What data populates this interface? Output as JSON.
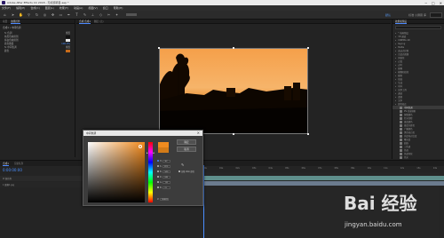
{
  "window": {
    "title": "Adobe After Effects CC 2018 - 无标题项目.aep *"
  },
  "menu": [
    "文件(F)",
    "编辑(E)",
    "合成(C)",
    "图层(L)",
    "效果(T)",
    "动画(A)",
    "视图(V)",
    "窗口",
    "帮助(H)"
  ],
  "toolbar": {
    "workspace_active": "默认",
    "workspace_other": "标准  小屏幕  库"
  },
  "left_panel": {
    "tabs": [
      "项目",
      "效果控件"
    ],
    "header": "合成1 • 中间色调",
    "rows": [
      {
        "label": "fx 色调",
        "value": "重置"
      },
      {
        "label": "将黑色映射到",
        "value": ""
      },
      {
        "label": "将白色映射到",
        "value": ""
      },
      {
        "label": "着色数量",
        "value": "100.0%"
      },
      {
        "label": "fx 中间色调",
        "value": "重置"
      },
      {
        "label": "颜色",
        "value": ""
      }
    ]
  },
  "comp_panel": {
    "tabs": [
      "合成 合成1",
      "图层 (无)"
    ]
  },
  "effects_panel": {
    "title": "效果和预设",
    "items": [
      {
        "label": "* 动画预设",
        "sub": false,
        "selected": false
      },
      {
        "label": "3D 通道",
        "sub": false,
        "selected": false
      },
      {
        "label": "CINEMA 4D",
        "sub": false,
        "selected": false
      },
      {
        "label": "Keying",
        "sub": false,
        "selected": false
      },
      {
        "label": "Matte",
        "sub": false,
        "selected": false
      },
      {
        "label": "表达式控制",
        "sub": false,
        "selected": false
      },
      {
        "label": "沉浸式视频",
        "sub": false,
        "selected": false
      },
      {
        "label": "风格化",
        "sub": false,
        "selected": false
      },
      {
        "label": "过渡",
        "sub": false,
        "selected": false
      },
      {
        "label": "过时",
        "sub": false,
        "selected": false
      },
      {
        "label": "抠像",
        "sub": false,
        "selected": false
      },
      {
        "label": "模糊和锐化",
        "sub": false,
        "selected": false
      },
      {
        "label": "模拟",
        "sub": false,
        "selected": false
      },
      {
        "label": "扭曲",
        "sub": false,
        "selected": false
      },
      {
        "label": "生成",
        "sub": false,
        "selected": false
      },
      {
        "label": "时间",
        "sub": false,
        "selected": false
      },
      {
        "label": "实用工具",
        "sub": false,
        "selected": false
      },
      {
        "label": "通道",
        "sub": false,
        "selected": false
      },
      {
        "label": "透视",
        "sub": false,
        "selected": false
      },
      {
        "label": "文本",
        "sub": false,
        "selected": false
      },
      {
        "label": "颜色校正",
        "sub": false,
        "selected": false
      },
      {
        "label": "中间色调",
        "sub": true,
        "selected": true
      },
      {
        "label": "PS 任意映射",
        "sub": true,
        "selected": false
      },
      {
        "label": "保留颜色",
        "sub": true,
        "selected": false
      },
      {
        "label": "灯光色阶",
        "sub": true,
        "selected": false
      },
      {
        "label": "更改颜色",
        "sub": true,
        "selected": false
      },
      {
        "label": "更改为颜色",
        "sub": true,
        "selected": false
      },
      {
        "label": "广播颜色",
        "sub": true,
        "selected": false
      },
      {
        "label": "黑色和白色",
        "sub": true,
        "selected": false
      },
      {
        "label": "亮度和对比度",
        "sub": true,
        "selected": false
      },
      {
        "label": "曝光度",
        "sub": true,
        "selected": false
      },
      {
        "label": "曲线",
        "sub": true,
        "selected": false
      },
      {
        "label": "三色调",
        "sub": true,
        "selected": false
      },
      {
        "label": "色调",
        "sub": true,
        "selected": false
      },
      {
        "label": "色调均化",
        "sub": true,
        "selected": false
      },
      {
        "label": "色光",
        "sub": true,
        "selected": false
      }
    ]
  },
  "timeline": {
    "tabs": [
      "合成1",
      "渲染队列"
    ],
    "timecode": "0:00:00:00",
    "ruler": [
      "0s",
      "01s",
      "02s",
      "03s",
      "04s",
      "05s",
      "06s",
      "07s",
      "08s",
      "09s",
      "10s",
      "11s",
      "12s",
      "13s",
      "14s"
    ],
    "layer_header": "# 源名称",
    "layer_name": "1  图像1.jpg"
  },
  "color_dialog": {
    "title": "中间色调",
    "ok": "确定",
    "cancel": "取消",
    "only_web": "仅限 Web 颜色",
    "fields": [
      {
        "label": "H:",
        "value": "30°",
        "on": true
      },
      {
        "label": "S:",
        "value": "89%",
        "on": false
      },
      {
        "label": "B:",
        "value": "94%",
        "on": false
      },
      {
        "label": "R:",
        "value": "240",
        "on": false
      },
      {
        "label": "G:",
        "value": "139",
        "on": false
      },
      {
        "label": "B:",
        "value": "31",
        "on": false
      }
    ],
    "hex": "F08B1F",
    "colors": {
      "new": "#f08b1f",
      "current": "#d37b18"
    }
  },
  "watermark": {
    "text": "Bai 经验",
    "sub": "jingyan.baidu.com"
  }
}
